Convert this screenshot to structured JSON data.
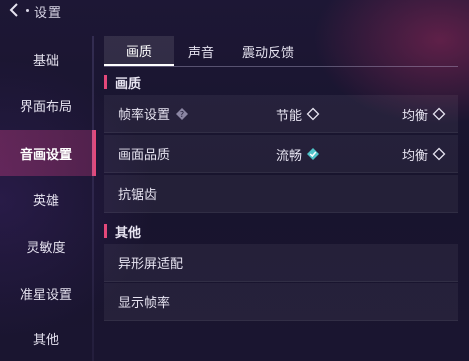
{
  "header": {
    "title": "设置"
  },
  "sidebar": {
    "items": [
      {
        "label": "基础"
      },
      {
        "label": "界面布局"
      },
      {
        "label": "音画设置"
      },
      {
        "label": "英雄"
      },
      {
        "label": "灵敏度"
      },
      {
        "label": "准星设置"
      },
      {
        "label": "其他"
      }
    ],
    "active_index": 2
  },
  "tabs": [
    {
      "label": "画质"
    },
    {
      "label": "声音"
    },
    {
      "label": "震动反馈"
    }
  ],
  "sections": {
    "quality": {
      "title": "画质",
      "rows": {
        "frame_rate": {
          "label": "帧率设置",
          "opt1": "节能",
          "opt2": "均衡"
        },
        "picture_quality": {
          "label": "画面品质",
          "opt1": "流畅",
          "opt2": "均衡"
        },
        "antialias": {
          "label": "抗锯齿"
        }
      }
    },
    "other": {
      "title": "其他",
      "rows": {
        "notch": {
          "label": "异形屏适配"
        },
        "show_fps": {
          "label": "显示帧率"
        }
      }
    }
  },
  "colors": {
    "accent": "#e4487a",
    "selected_check": "#4fc3c8",
    "background": "#1a1530"
  }
}
